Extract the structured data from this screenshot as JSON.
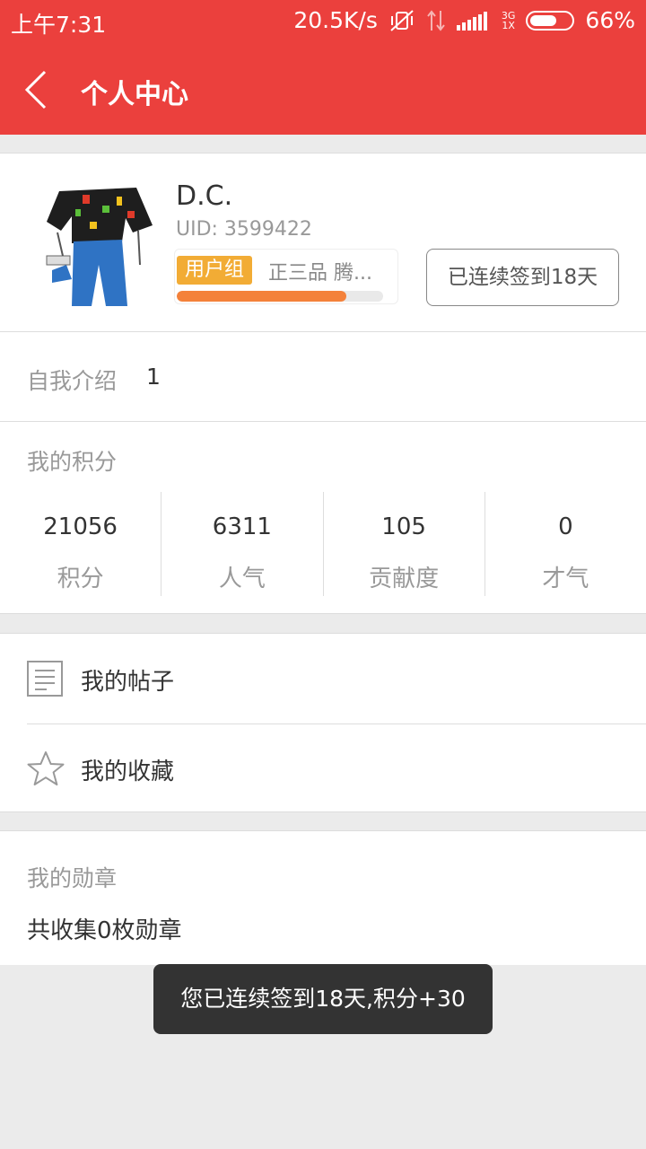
{
  "status_bar": {
    "time": "上午7:31",
    "net_speed": "20.5K/s",
    "network_type_top": "3G",
    "network_type_bottom": "1X",
    "battery": "66%",
    "battery_level": 0.66
  },
  "header": {
    "title": "个人中心"
  },
  "profile": {
    "username": "D.C.",
    "uid": "UID: 3599422",
    "group_label": "用户组",
    "group_name": "正三品 腾...",
    "progress_fraction": 0.82,
    "checkin_label": "已连续签到18天"
  },
  "intro": {
    "label": "自我介绍",
    "value": "1"
  },
  "points": {
    "label": "我的积分",
    "stats": [
      {
        "value": "21056",
        "label": "积分"
      },
      {
        "value": "6311",
        "label": "人气"
      },
      {
        "value": "105",
        "label": "贡献度"
      },
      {
        "value": "0",
        "label": "才气"
      }
    ]
  },
  "menu": {
    "items": [
      {
        "label": "我的帖子",
        "icon": "document-icon"
      },
      {
        "label": "我的收藏",
        "icon": "star-icon"
      }
    ]
  },
  "medals": {
    "label": "我的勋章",
    "value": "共收集0枚勋章"
  },
  "toast": {
    "message": "您已连续签到18天,积分+30"
  },
  "colors": {
    "primary": "#eb403d",
    "badge": "#f2ac35",
    "progress": "#f4813a"
  }
}
